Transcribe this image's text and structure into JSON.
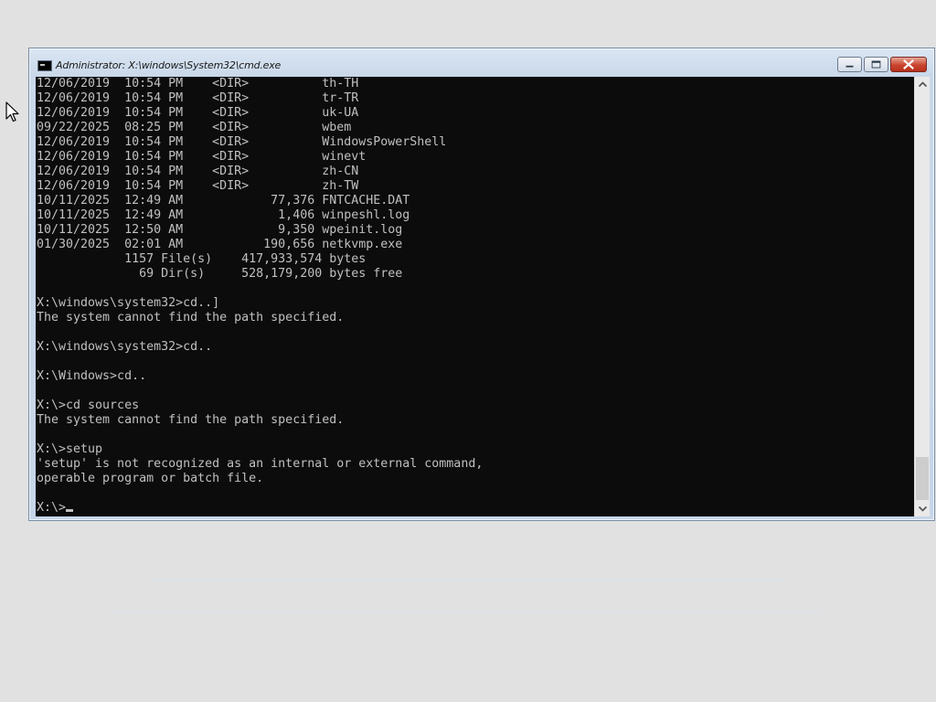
{
  "window": {
    "title": "Administrator: X:\\windows\\System32\\cmd.exe"
  },
  "icons": {
    "app": "cmd-icon",
    "minimize": "minimize-icon",
    "maximize": "maximize-icon",
    "close": "close-icon",
    "scroll_up": "chevron-up-icon",
    "scroll_down": "chevron-down-icon",
    "cursor": "mouse-pointer-icon"
  },
  "colors": {
    "console_bg": "#0c0c0c",
    "console_text": "#c0c0c0",
    "close_button": "#c9452f"
  },
  "console": {
    "lines": [
      "12/06/2019  10:54 PM    <DIR>          th-TH",
      "12/06/2019  10:54 PM    <DIR>          tr-TR",
      "12/06/2019  10:54 PM    <DIR>          uk-UA",
      "09/22/2025  08:25 PM    <DIR>          wbem",
      "12/06/2019  10:54 PM    <DIR>          WindowsPowerShell",
      "12/06/2019  10:54 PM    <DIR>          winevt",
      "12/06/2019  10:54 PM    <DIR>          zh-CN",
      "12/06/2019  10:54 PM    <DIR>          zh-TW",
      "10/11/2025  12:49 AM            77,376 FNTCACHE.DAT",
      "10/11/2025  12:49 AM             1,406 winpeshl.log",
      "10/11/2025  12:50 AM             9,350 wpeinit.log",
      "01/30/2025  02:01 AM           190,656 netkvmp.exe",
      "            1157 File(s)    417,933,574 bytes",
      "              69 Dir(s)     528,179,200 bytes free",
      "",
      "X:\\windows\\system32>cd..]",
      "The system cannot find the path specified.",
      "",
      "X:\\windows\\system32>cd..",
      "",
      "X:\\Windows>cd..",
      "",
      "X:\\>cd sources",
      "The system cannot find the path specified.",
      "",
      "X:\\>setup",
      "'setup' is not recognized as an internal or external command,",
      "operable program or batch file.",
      ""
    ],
    "prompt": "X:\\>"
  }
}
